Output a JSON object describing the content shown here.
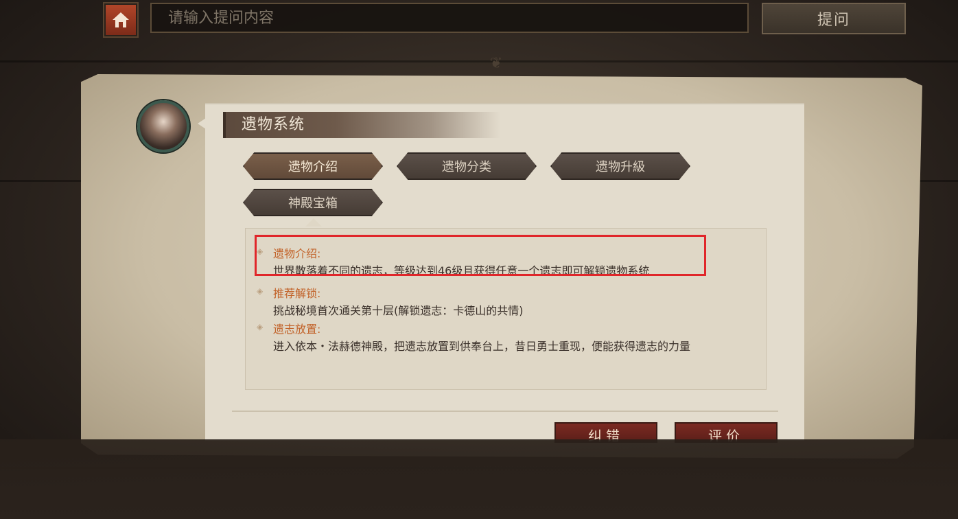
{
  "search": {
    "placeholder": "请输入提问内容",
    "value": ""
  },
  "ask_button": "提问",
  "panel": {
    "title": "遗物系统",
    "tabs": [
      {
        "label": "遗物介绍",
        "active": true
      },
      {
        "label": "遗物分类",
        "active": false
      },
      {
        "label": "遗物升級",
        "active": false
      },
      {
        "label": "神殿宝箱",
        "active": false
      }
    ],
    "sections": [
      {
        "heading": "遗物介绍:",
        "body": "世界散落着不同的遗志，等级达到46级且获得任意一个遗志即可解锁遗物系统"
      },
      {
        "heading": "推荐解锁:",
        "body": "挑战秘境首次通关第十层(解锁遗志：卡德山的共情)"
      },
      {
        "heading": "遗志放置:",
        "body": "进入依本・法赫德神殿，把遗志放置到供奉台上，昔日勇士重现，便能获得遗志的力量"
      }
    ],
    "footer_buttons": {
      "report": "纠错",
      "rate": "评价"
    }
  },
  "colors": {
    "heading": "#c2632a",
    "highlight": "#e0262a",
    "active_tab": "#7a5f4a"
  }
}
